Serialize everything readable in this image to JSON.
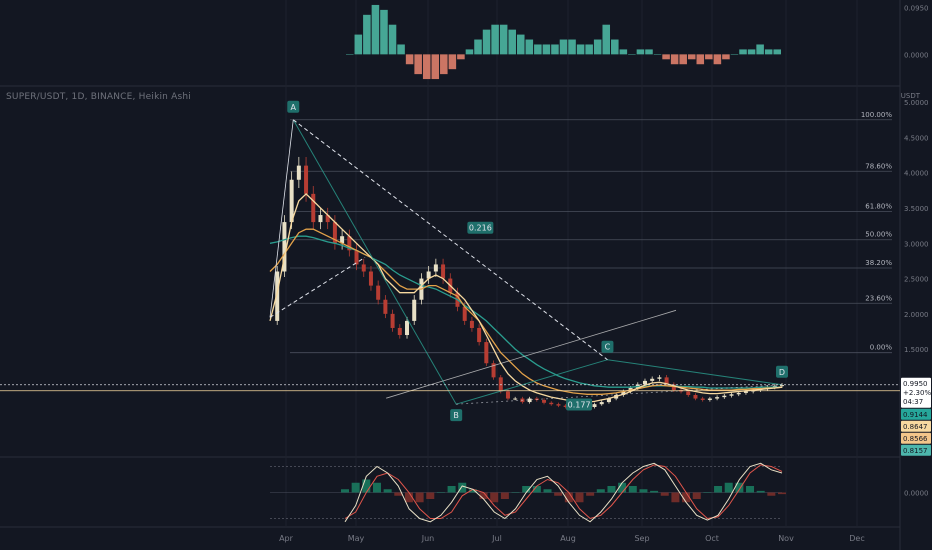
{
  "header": {
    "symbol_line": "SUPER/USDT, 1D, BINANCE, Heikin Ashi",
    "currency": "USDT"
  },
  "colors": {
    "background": "#131722",
    "up": "#e8e0c6",
    "down": "#b73d33",
    "macd_up": "#4db6a2",
    "macd_down": "#e07f6c",
    "ema_fast": "#f7d9a0",
    "ema_mid": "#e3a24a",
    "ema_slow": "#2a9d8f",
    "fib": "#4a4f5c",
    "pattern": "#e0e3eb"
  },
  "chart_data": [
    {
      "type": "bar",
      "title": "",
      "pane": "macd",
      "yticks": [
        "0.0950",
        "0.0000"
      ],
      "ylim": [
        -0.06,
        0.11
      ],
      "histogram": [
        0.0,
        0.04,
        0.08,
        0.1,
        0.09,
        0.06,
        0.02,
        -0.02,
        -0.04,
        -0.05,
        -0.05,
        -0.04,
        -0.03,
        -0.01,
        0.01,
        0.03,
        0.05,
        0.06,
        0.06,
        0.05,
        0.04,
        0.03,
        0.02,
        0.02,
        0.02,
        0.03,
        0.03,
        0.02,
        0.02,
        0.03,
        0.06,
        0.03,
        0.01,
        0.0,
        0.01,
        0.01,
        0.0,
        -0.01,
        -0.02,
        -0.02,
        -0.01,
        -0.02,
        -0.01,
        -0.02,
        -0.01,
        0.0,
        0.01,
        0.01,
        0.02,
        0.01,
        0.01
      ]
    },
    {
      "type": "line",
      "title": "",
      "pane": "price",
      "x_labels": [
        "Apr",
        "May",
        "Jun",
        "Jul",
        "Aug",
        "Sep",
        "Oct",
        "Nov",
        "Dec"
      ],
      "yticks": [
        "5.0000",
        "4.5000",
        "4.0000",
        "3.5000",
        "3.0000",
        "2.5000",
        "2.0000",
        "1.5000"
      ],
      "ylim": [
        0.0,
        5.2
      ],
      "close_daily": [
        1.9,
        2.6,
        3.3,
        3.9,
        4.1,
        3.7,
        3.3,
        3.4,
        3.3,
        3.0,
        3.1,
        2.9,
        2.7,
        2.6,
        2.4,
        2.2,
        2.0,
        1.8,
        1.7,
        1.9,
        2.2,
        2.5,
        2.6,
        2.7,
        2.5,
        2.3,
        2.1,
        1.9,
        1.8,
        1.6,
        1.3,
        1.1,
        0.9,
        0.8,
        0.8,
        0.75,
        0.8,
        0.78,
        0.74,
        0.72,
        0.7,
        0.68,
        0.66,
        0.66,
        0.68,
        0.72,
        0.75,
        0.8,
        0.85,
        0.9,
        0.95,
        1.0,
        1.05,
        1.08,
        1.1,
        1.0,
        0.92,
        0.9,
        0.85,
        0.8,
        0.78,
        0.8,
        0.82,
        0.84,
        0.86,
        0.88,
        0.9,
        0.92,
        0.94,
        0.96,
        0.98,
        0.99
      ],
      "ema_fast": [
        1.9,
        2.3,
        2.8,
        3.3,
        3.6,
        3.7,
        3.6,
        3.5,
        3.4,
        3.3,
        3.2,
        3.1,
        3.0,
        2.9,
        2.8,
        2.7,
        2.5,
        2.4,
        2.3,
        2.3,
        2.3,
        2.4,
        2.5,
        2.55,
        2.5,
        2.4,
        2.3,
        2.2,
        2.05,
        1.9,
        1.7,
        1.5,
        1.3,
        1.15,
        1.05,
        0.98,
        0.92,
        0.88,
        0.85,
        0.82,
        0.8,
        0.78,
        0.76,
        0.75,
        0.75,
        0.76,
        0.78,
        0.8,
        0.83,
        0.86,
        0.9,
        0.95,
        0.99,
        1.02,
        1.03,
        1.01,
        0.98,
        0.95,
        0.92,
        0.9,
        0.88,
        0.87,
        0.87,
        0.88,
        0.89,
        0.9,
        0.91,
        0.92,
        0.93,
        0.94,
        0.95,
        0.96
      ],
      "ema_mid": [
        2.6,
        2.7,
        2.85,
        3.0,
        3.15,
        3.2,
        3.2,
        3.15,
        3.1,
        3.05,
        3.0,
        2.95,
        2.9,
        2.85,
        2.8,
        2.7,
        2.6,
        2.5,
        2.4,
        2.35,
        2.35,
        2.35,
        2.4,
        2.4,
        2.35,
        2.3,
        2.25,
        2.1,
        2.0,
        1.9,
        1.75,
        1.6,
        1.45,
        1.35,
        1.25,
        1.15,
        1.08,
        1.02,
        0.98,
        0.95,
        0.92,
        0.9,
        0.88,
        0.87,
        0.86,
        0.86,
        0.86,
        0.87,
        0.88,
        0.9,
        0.92,
        0.94,
        0.96,
        0.98,
        0.99,
        0.98,
        0.97,
        0.96,
        0.95,
        0.94,
        0.93,
        0.92,
        0.92,
        0.92,
        0.92,
        0.93,
        0.93,
        0.94,
        0.94,
        0.95,
        0.95,
        0.96
      ],
      "ema_slow": [
        3.0,
        3.02,
        3.05,
        3.08,
        3.1,
        3.1,
        3.08,
        3.05,
        3.02,
        3.0,
        2.97,
        2.93,
        2.9,
        2.85,
        2.8,
        2.75,
        2.7,
        2.62,
        2.55,
        2.5,
        2.45,
        2.4,
        2.38,
        2.35,
        2.3,
        2.25,
        2.2,
        2.12,
        2.05,
        1.98,
        1.9,
        1.8,
        1.7,
        1.6,
        1.5,
        1.42,
        1.35,
        1.28,
        1.22,
        1.17,
        1.12,
        1.08,
        1.05,
        1.02,
        1.0,
        0.98,
        0.97,
        0.96,
        0.96,
        0.96,
        0.96,
        0.97,
        0.97,
        0.98,
        0.98,
        0.98,
        0.98,
        0.97,
        0.97,
        0.96,
        0.96,
        0.95,
        0.95,
        0.95,
        0.95,
        0.95,
        0.95,
        0.95,
        0.96,
        0.96,
        0.96,
        0.96
      ],
      "fib_levels": [
        {
          "label": "100.00%",
          "price": 4.75
        },
        {
          "label": "78.60%",
          "price": 4.02
        },
        {
          "label": "61.80%",
          "price": 3.45
        },
        {
          "label": "50.00%",
          "price": 3.05
        },
        {
          "label": "38.20%",
          "price": 2.65
        },
        {
          "label": "23.60%",
          "price": 2.15
        },
        {
          "label": "0.00%",
          "price": 1.45
        }
      ],
      "pattern_points": [
        {
          "label": "A",
          "day": 4,
          "price": 4.75
        },
        {
          "label": "B",
          "day": 32,
          "price": 0.72
        },
        {
          "label": "C",
          "day": 58,
          "price": 1.35
        },
        {
          "label": "D",
          "day": 88,
          "price": 0.995
        }
      ],
      "ratio_labels": [
        "0.216",
        "0.177"
      ],
      "price_tags": [
        {
          "text": "0.9950",
          "sub": "+2.30%",
          "sub2": "04:37",
          "price": 0.995,
          "bg": "#ffffff",
          "fg": "#131722"
        },
        {
          "text": "0.9144",
          "price": 0.9144,
          "bg": "#26a69a",
          "fg": "#131722"
        },
        {
          "text": "0.8647",
          "price": 0.8647,
          "bg": "#f7d9a0",
          "fg": "#131722"
        },
        {
          "text": "0.8566",
          "price": 0.8566,
          "bg": "#f3c58a",
          "fg": "#131722"
        },
        {
          "text": "0.8157",
          "price": 0.8157,
          "bg": "#4db6ac",
          "fg": "#131722"
        }
      ]
    },
    {
      "type": "line",
      "title": "",
      "pane": "oscillator",
      "yticks": [
        "0.0000"
      ],
      "ylim": [
        -1,
        1
      ],
      "k": [
        -0.9,
        -0.4,
        0.5,
        0.8,
        0.6,
        0.2,
        -0.5,
        -0.8,
        -0.9,
        -0.7,
        -0.3,
        0.2,
        0.1,
        -0.2,
        -0.6,
        -0.8,
        -0.5,
        0.0,
        0.4,
        0.5,
        0.2,
        -0.3,
        -0.7,
        -0.9,
        -0.6,
        -0.2,
        0.3,
        0.6,
        0.8,
        0.9,
        0.7,
        0.2,
        -0.3,
        -0.7,
        -0.85,
        -0.7,
        -0.2,
        0.4,
        0.8,
        0.9,
        0.7,
        0.6
      ],
      "d": [
        -0.8,
        -0.6,
        0.0,
        0.5,
        0.6,
        0.4,
        0.0,
        -0.5,
        -0.8,
        -0.8,
        -0.6,
        -0.1,
        0.1,
        0.0,
        -0.4,
        -0.7,
        -0.6,
        -0.2,
        0.2,
        0.4,
        0.3,
        0.0,
        -0.5,
        -0.8,
        -0.7,
        -0.4,
        0.0,
        0.4,
        0.7,
        0.85,
        0.8,
        0.5,
        0.0,
        -0.5,
        -0.8,
        -0.75,
        -0.4,
        0.1,
        0.6,
        0.85,
        0.8,
        0.65
      ],
      "histogram": [
        0.1,
        0.3,
        0.4,
        0.3,
        0.1,
        -0.1,
        -0.3,
        -0.3,
        -0.2,
        0.0,
        0.2,
        0.3,
        0.1,
        -0.2,
        -0.3,
        -0.2,
        0.0,
        0.2,
        0.2,
        0.1,
        -0.1,
        -0.3,
        -0.3,
        -0.1,
        0.1,
        0.2,
        0.3,
        0.2,
        0.1,
        0.05,
        -0.1,
        -0.3,
        -0.3,
        -0.2,
        0.0,
        0.2,
        0.3,
        0.3,
        0.2,
        0.05,
        -0.1,
        -0.05
      ]
    }
  ]
}
